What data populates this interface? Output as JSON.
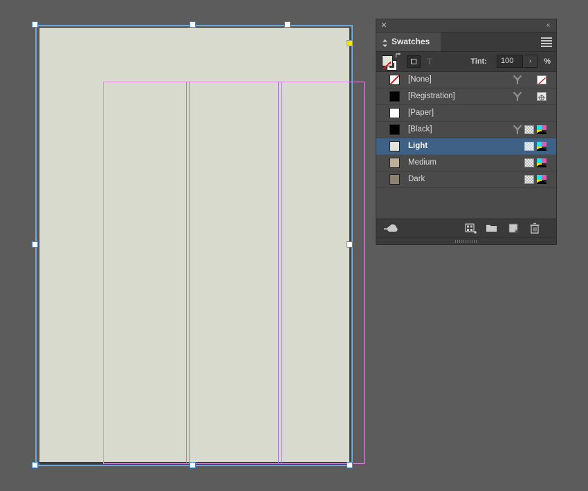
{
  "app": {
    "canvas_background": "#5c5c5c",
    "page_background": "#d8dace",
    "selection_color": "#6fa8dc",
    "margin_guide_color": "#e48ce4",
    "column_guide_color": "#a47fd4",
    "accent_selected_row": "#3e6185"
  },
  "document": {
    "name": "document-page",
    "columns": 3,
    "handles": [
      {
        "name": "handle-top-left"
      },
      {
        "name": "handle-top-center"
      },
      {
        "name": "handle-top-right"
      },
      {
        "name": "handle-middle-left"
      },
      {
        "name": "handle-middle-right"
      },
      {
        "name": "handle-bottom-left"
      },
      {
        "name": "handle-bottom-center"
      },
      {
        "name": "handle-bottom-right"
      },
      {
        "name": "handle-transform-point"
      }
    ]
  },
  "panel": {
    "close_glyph": "✕",
    "collapse_glyph": "«",
    "tab_label": "Swatches",
    "menu_icon": "panel-menu-icon",
    "dock_icon": "dock-toggle-icon"
  },
  "controls": {
    "fill_color": "#e2e4da",
    "stroke_color": "#ffffff",
    "formatting_container_icon": "formatting-affects-container",
    "formatting_text_icon": "formatting-affects-text",
    "formatting_text_glyph": "T",
    "tint_label": "Tint:",
    "tint_value": "100",
    "tint_placeholder": "100",
    "tint_stepper_glyph": "›",
    "tint_unit": "%"
  },
  "swatches": {
    "rows": [
      {
        "name": "[None]",
        "chip": "none",
        "chip_color": "#ffffff",
        "selected": false,
        "has_pin": true,
        "has_tint_icon": false,
        "right_icon": "none-box"
      },
      {
        "name": "[Registration]",
        "chip": "solid",
        "chip_color": "#000000",
        "selected": false,
        "has_pin": true,
        "has_tint_icon": false,
        "right_icon": "registration-box"
      },
      {
        "name": "[Paper]",
        "chip": "solid",
        "chip_color": "#ffffff",
        "selected": false,
        "has_pin": false,
        "has_tint_icon": false,
        "right_icon": "none"
      },
      {
        "name": "[Black]",
        "chip": "solid",
        "chip_color": "#000000",
        "selected": false,
        "has_pin": true,
        "has_tint_icon": true,
        "right_icon": "cmyk"
      },
      {
        "name": "Light",
        "chip": "solid",
        "chip_color": "#e2e4da",
        "selected": true,
        "has_pin": false,
        "has_tint_icon": true,
        "right_icon": "cmyk"
      },
      {
        "name": "Medium",
        "chip": "solid",
        "chip_color": "#bfb09b",
        "selected": false,
        "has_pin": false,
        "has_tint_icon": true,
        "right_icon": "cmyk"
      },
      {
        "name": "Dark",
        "chip": "solid",
        "chip_color": "#8f8271",
        "selected": false,
        "has_pin": false,
        "has_tint_icon": true,
        "right_icon": "cmyk"
      }
    ]
  },
  "footer": {
    "buttons": [
      {
        "name": "cc-libraries-button",
        "icon": "cloud-icon"
      },
      {
        "name": "new-color-group-button",
        "icon": "color-group-icon"
      },
      {
        "name": "new-swatch-group-folder-button",
        "icon": "folder-icon"
      },
      {
        "name": "new-swatch-button",
        "icon": "new-swatch-icon"
      },
      {
        "name": "delete-swatch-button",
        "icon": "trash-icon"
      }
    ]
  }
}
